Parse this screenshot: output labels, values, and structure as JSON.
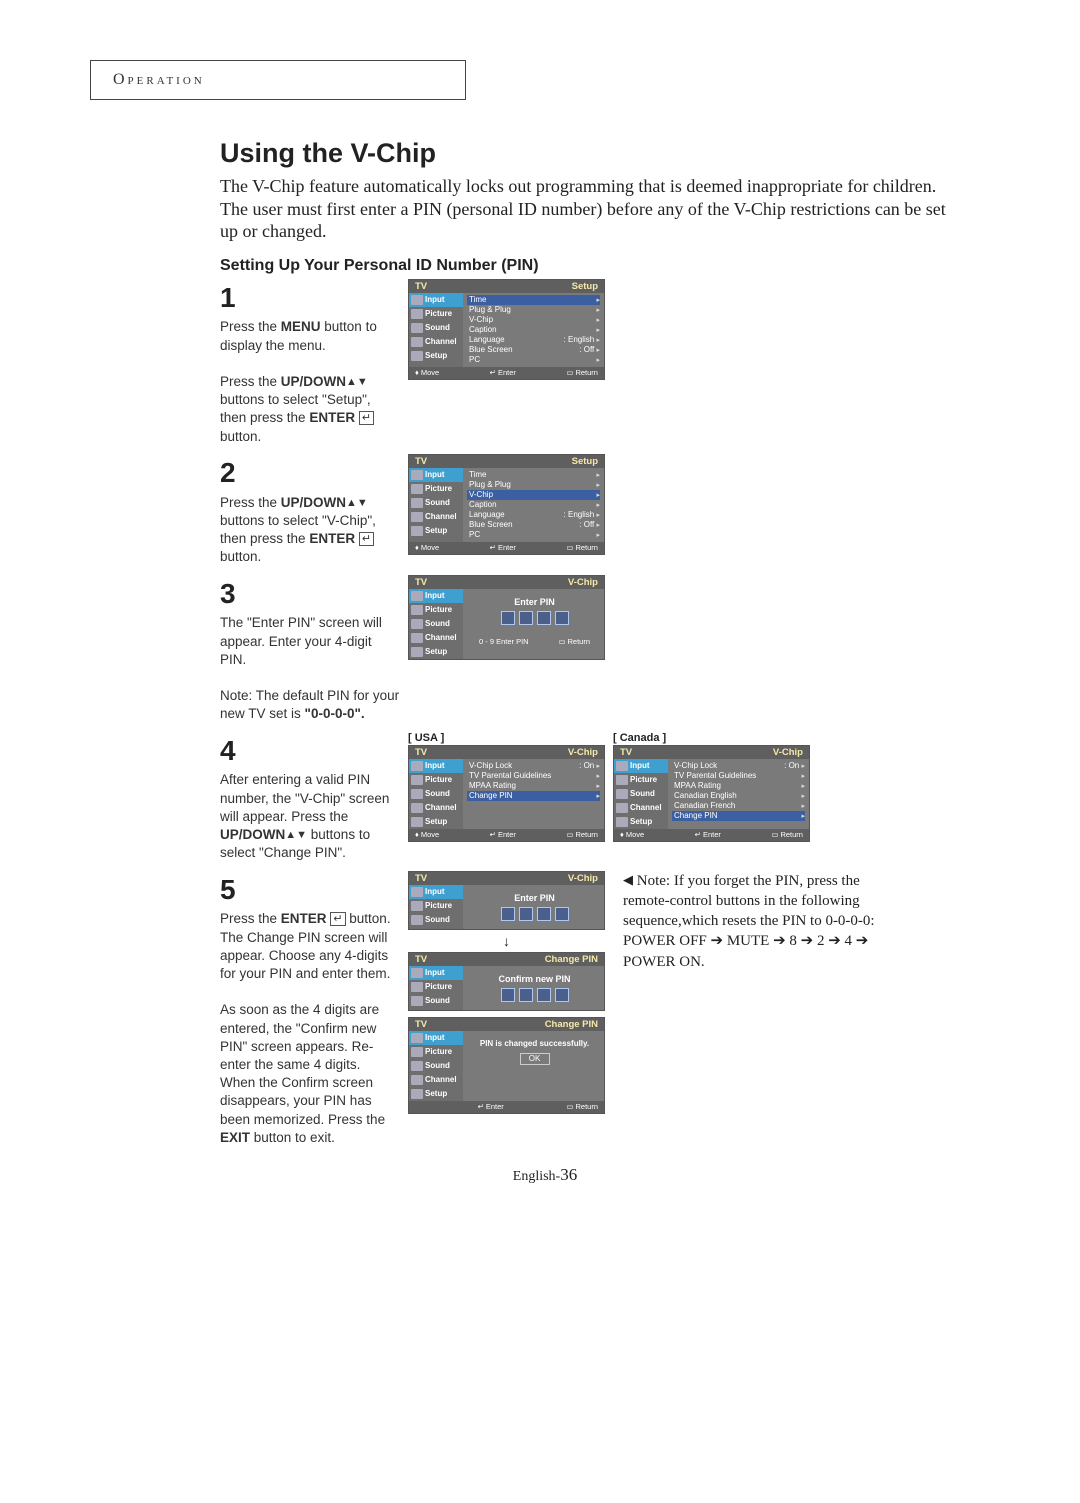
{
  "header": "Operation",
  "title": "Using the V-Chip",
  "intro": "The V-Chip feature automatically locks out programming that is deemed inappropriate for children. The user must first enter a PIN (personal ID number) before any of the V-Chip restrictions can be set up or changed.",
  "subhead": "Setting Up Your Personal ID Number (PIN)",
  "side_labels": [
    "Input",
    "Picture",
    "Sound",
    "Channel",
    "Setup"
  ],
  "setup_menu_items": [
    {
      "label": "Time"
    },
    {
      "label": "Plug & Plug"
    },
    {
      "label": "V-Chip"
    },
    {
      "label": "Caption"
    },
    {
      "label": "Language",
      "value": "English"
    },
    {
      "label": "Blue Screen",
      "value": "Off"
    },
    {
      "label": "PC"
    }
  ],
  "vchip_usa_items": [
    {
      "label": "V-Chip Lock",
      "value": "On"
    },
    {
      "label": "TV Parental Guidelines"
    },
    {
      "label": "MPAA Rating"
    },
    {
      "label": "Change PIN"
    }
  ],
  "vchip_canada_items": [
    {
      "label": "V-Chip Lock",
      "value": "On"
    },
    {
      "label": "TV Parental Guidelines"
    },
    {
      "label": "MPAA Rating"
    },
    {
      "label": "Canadian English"
    },
    {
      "label": "Canadian French"
    },
    {
      "label": "Change PIN"
    }
  ],
  "footer_nav": {
    "move": "Move",
    "enter": "Enter",
    "return": "Return"
  },
  "pin_footer": {
    "left": "0 - 9 Enter PIN",
    "right": "Return"
  },
  "labels": {
    "tv": "TV",
    "setup": "Setup",
    "vchip": "V-Chip",
    "changepin": "Change PIN",
    "enterpin": "Enter PIN",
    "confirmnew": "Confirm new PIN",
    "pinchanged": "PIN is changed successfully.",
    "ok": "OK",
    "usa": "[ USA ]",
    "canada": "[ Canada ]"
  },
  "steps": {
    "s1_a": "Press the ",
    "s1_b": "MENU",
    "s1_c": " button to display the menu.",
    "s1_d": "Press the ",
    "s1_e": "UP/DOWN",
    "s1_f": " buttons to select \"Setup\", then press the ",
    "s1_g": "ENTER",
    "s1_h": " button.",
    "s2_a": "Press the ",
    "s2_b": "UP/DOWN",
    "s2_c": " buttons to select \"V-Chip\", then press the ",
    "s2_d": "ENTER",
    "s2_e": " button.",
    "s3_a": "The \"Enter PIN\" screen will appear. Enter your 4-digit PIN.",
    "s3_b": "Note: The default PIN for your new TV set is ",
    "s3_c": "\"0-0-0-0\".",
    "s4_a": "After entering a valid PIN number, the \"V-Chip\" screen will appear. Press the ",
    "s4_b": "UP/DOWN",
    "s4_c": " buttons to select \"Change PIN\".",
    "s5_a": "Press the ",
    "s5_b": "ENTER",
    "s5_c": " button.",
    "s5_d": "The Change PIN screen will appear. Choose any 4-digits for your PIN and enter them.",
    "s5_e": "As soon as the 4 digits are entered, the \"Confirm new PIN\" screen appears. Re-enter the same 4 digits.",
    "s5_f": "When the Confirm screen disappears, your PIN has been memorized. Press the ",
    "s5_g": "EXIT",
    "s5_h": " button to exit."
  },
  "note": {
    "a": "Note: If you forget the PIN, press the remote-control buttons in the following sequence,which resets the PIN to 0-0-0-0:",
    "b": "POWER OFF ➔ MUTE ➔ 8 ➔ 2 ➔ 4 ➔ POWER ON."
  },
  "pagenum_prefix": "English-",
  "pagenum": "36"
}
